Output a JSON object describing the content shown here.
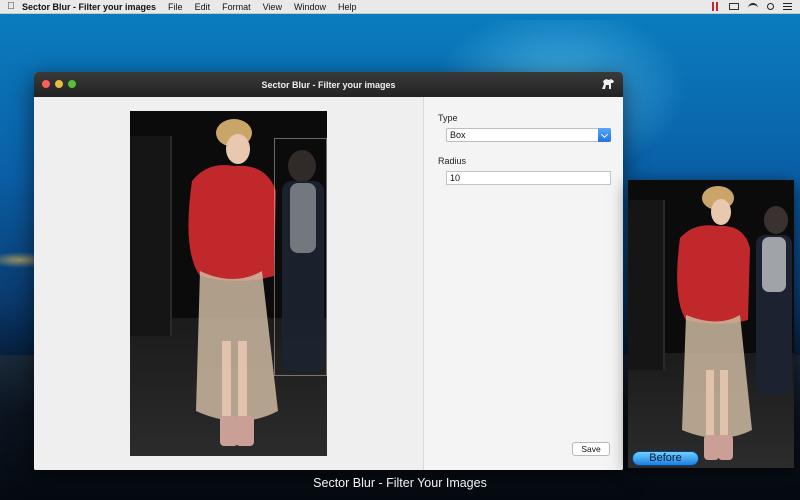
{
  "menubar": {
    "app_name": "Sector Blur - Filter your images",
    "menus": [
      "File",
      "Edit",
      "Format",
      "View",
      "Window",
      "Help"
    ],
    "status_icons": [
      "pause-icon",
      "display-icon",
      "wifi-icon",
      "search-icon",
      "list-icon"
    ]
  },
  "window": {
    "title": "Sector Blur - Filter your images"
  },
  "settings": {
    "type_label": "Type",
    "type_value": "Box",
    "radius_label": "Radius",
    "radius_value": "10",
    "save_label": "Save"
  },
  "before_label": "Before",
  "caption": "Sector Blur - Filter Your Images",
  "colors": {
    "accent_blue": "#1d72e8",
    "window_titlebar": "#2d2d2d",
    "close": "#fc5b57",
    "minimize": "#e5bf3c",
    "maximize": "#57c038",
    "jacket_red": "#c0282c"
  }
}
